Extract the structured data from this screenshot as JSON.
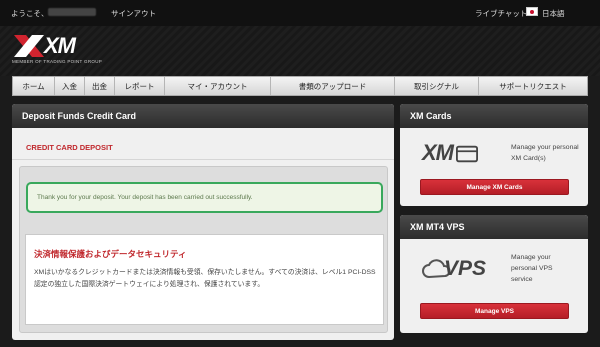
{
  "topbar": {
    "welcome": "ようこそ、",
    "signout": "サインアウト",
    "livechat": "ライブチャット",
    "language": "日本語"
  },
  "logo": {
    "text": "XM",
    "tagline": "MEMBER OF TRADING POINT GROUP"
  },
  "nav": {
    "items": [
      {
        "label": "ホーム"
      },
      {
        "label": "入金"
      },
      {
        "label": "出金"
      },
      {
        "label": "レポート"
      },
      {
        "label": "マイ・アカウント"
      },
      {
        "label": "書類のアップロード"
      },
      {
        "label": "取引シグナル"
      },
      {
        "label": "サポートリクエスト"
      }
    ]
  },
  "main": {
    "title": "Deposit Funds Credit Card",
    "section_title": "CREDIT CARD DEPOSIT",
    "success_message": "Thank you for your deposit. Your deposit has been carried out successfully.",
    "info_title": "決済情報保護およびデータセキュリティ",
    "info_text": "XMはいかなるクレジットカードまたは決済情報も受領、保存いたしません。すべての決済は、レベル1 PCI-DSS認定の独立した国際決済ゲートウェイにより処理され、保護されています。"
  },
  "sidebar": {
    "xm_cards": {
      "title": "XM Cards",
      "logo_text": "XM",
      "description": "Manage your personal XM Card(s)",
      "button": "Manage XM Cards"
    },
    "vps": {
      "title": "XM MT4 VPS",
      "logo_text": "VPS",
      "description": "Manage your personal VPS service",
      "button": "Manage VPS"
    }
  },
  "colors": {
    "accent_red": "#c0282d",
    "success_green": "#39a85c",
    "dark_bg": "#1b1b1b"
  }
}
